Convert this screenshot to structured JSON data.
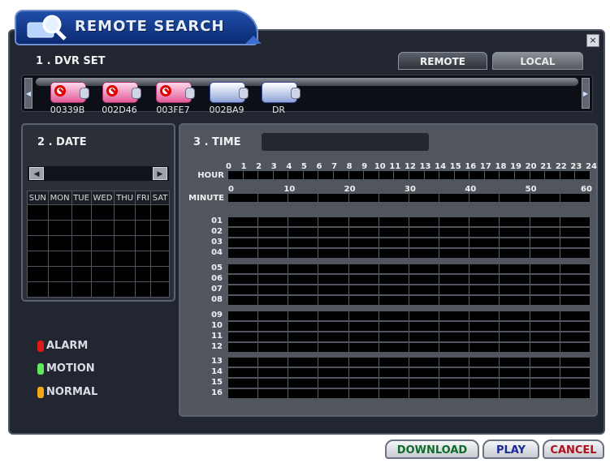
{
  "title": "REMOTE SEARCH",
  "close_label": "×",
  "dvr_set": {
    "section_title": "1 . DVR SET",
    "tabs": [
      {
        "label": "REMOTE",
        "active": true
      },
      {
        "label": "LOCAL",
        "active": false
      }
    ],
    "items": [
      {
        "label": "00339B",
        "status": "disabled"
      },
      {
        "label": "002D46",
        "status": "disabled"
      },
      {
        "label": "003FE7",
        "status": "disabled"
      },
      {
        "label": "002BA9",
        "status": "available"
      },
      {
        "label": "DR",
        "status": "available"
      }
    ]
  },
  "date": {
    "section_title": "2 . DATE",
    "days": [
      "SUN",
      "MON",
      "TUE",
      "WED",
      "THU",
      "FRI",
      "SAT"
    ]
  },
  "legend": [
    {
      "label": "ALARM",
      "color": "#e01818"
    },
    {
      "label": "MOTION",
      "color": "#5ee85e"
    },
    {
      "label": "NORMAL",
      "color": "#f0a818"
    }
  ],
  "time": {
    "section_title": "3 . TIME",
    "hour_label": "HOUR",
    "minute_label": "MINUTE",
    "hour_ticks": [
      "0",
      "1",
      "2",
      "3",
      "4",
      "5",
      "6",
      "7",
      "8",
      "9",
      "10",
      "11",
      "12",
      "13",
      "14",
      "15",
      "16",
      "17",
      "18",
      "19",
      "20",
      "21",
      "22",
      "23",
      "24"
    ],
    "minute_ticks": [
      "0",
      "10",
      "20",
      "30",
      "40",
      "50",
      "60"
    ],
    "channels": [
      "01",
      "02",
      "03",
      "04",
      "05",
      "06",
      "07",
      "08",
      "09",
      "10",
      "11",
      "12",
      "13",
      "14",
      "15",
      "16"
    ]
  },
  "buttons": {
    "download": "DOWNLOAD",
    "play": "PLAY",
    "cancel": "CANCEL"
  },
  "colors": {
    "download": "#0e6b2a",
    "play": "#1a2a9a",
    "cancel": "#b01020"
  }
}
